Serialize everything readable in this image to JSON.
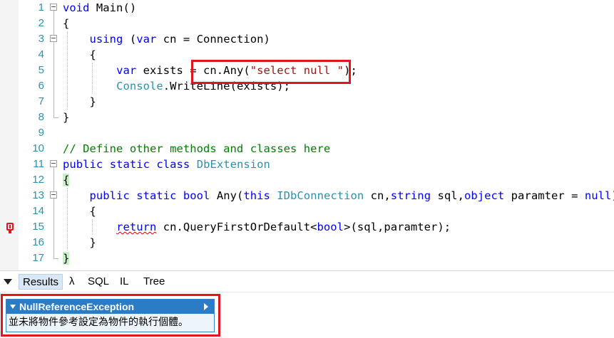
{
  "editor": {
    "lines": [
      {
        "n": "1",
        "tokens": [
          {
            "t": "void",
            "c": "kw"
          },
          {
            "t": " Main()"
          }
        ]
      },
      {
        "n": "2",
        "tokens": [
          {
            "t": "{"
          }
        ]
      },
      {
        "n": "3",
        "tokens": [
          {
            "t": "    "
          },
          {
            "t": "using",
            "c": "kw"
          },
          {
            "t": " ("
          },
          {
            "t": "var",
            "c": "kw"
          },
          {
            "t": " cn = Connection)"
          }
        ]
      },
      {
        "n": "4",
        "tokens": [
          {
            "t": "    {"
          }
        ]
      },
      {
        "n": "5",
        "tokens": [
          {
            "t": "        "
          },
          {
            "t": "var",
            "c": "kw"
          },
          {
            "t": " exists = cn.Any("
          },
          {
            "t": "\"select null \"",
            "c": "str"
          },
          {
            "t": ");"
          }
        ]
      },
      {
        "n": "6",
        "tokens": [
          {
            "t": "        "
          },
          {
            "t": "Console",
            "c": "ty"
          },
          {
            "t": ".WriteLine(exists);"
          }
        ]
      },
      {
        "n": "7",
        "tokens": [
          {
            "t": "    }"
          }
        ]
      },
      {
        "n": "8",
        "tokens": [
          {
            "t": "}"
          }
        ]
      },
      {
        "n": "9",
        "tokens": []
      },
      {
        "n": "10",
        "tokens": [
          {
            "t": "// Define other methods and classes here",
            "c": "cm"
          }
        ]
      },
      {
        "n": "11",
        "tokens": [
          {
            "t": "public",
            "c": "kw"
          },
          {
            "t": " "
          },
          {
            "t": "static",
            "c": "kw"
          },
          {
            "t": " "
          },
          {
            "t": "class",
            "c": "kw"
          },
          {
            "t": " "
          },
          {
            "t": "DbExtension",
            "c": "ty"
          }
        ]
      },
      {
        "n": "12",
        "tokens": [
          {
            "t": "{",
            "c": "brace-hl"
          }
        ]
      },
      {
        "n": "13",
        "tokens": [
          {
            "t": "    "
          },
          {
            "t": "public",
            "c": "kw"
          },
          {
            "t": " "
          },
          {
            "t": "static",
            "c": "kw"
          },
          {
            "t": " "
          },
          {
            "t": "bool",
            "c": "kw"
          },
          {
            "t": " Any("
          },
          {
            "t": "this",
            "c": "kw"
          },
          {
            "t": " "
          },
          {
            "t": "IDbConnection",
            "c": "ty"
          },
          {
            "t": " cn,"
          },
          {
            "t": "string",
            "c": "kw"
          },
          {
            "t": " sql,"
          },
          {
            "t": "object",
            "c": "kw"
          },
          {
            "t": " paramter = "
          },
          {
            "t": "null",
            "c": "kw"
          },
          {
            "t": ")"
          }
        ]
      },
      {
        "n": "14",
        "tokens": [
          {
            "t": "    {"
          }
        ]
      },
      {
        "n": "15",
        "tokens": [
          {
            "t": "        "
          },
          {
            "t": "return",
            "c": "kw err-u"
          },
          {
            "t": " cn.QueryFirstOrDefault<"
          },
          {
            "t": "bool",
            "c": "kw"
          },
          {
            "t": ">(sql,paramter);"
          }
        ]
      },
      {
        "n": "16",
        "tokens": [
          {
            "t": "    }"
          }
        ]
      },
      {
        "n": "17",
        "tokens": [
          {
            "t": "}",
            "c": "brace-hl"
          }
        ]
      }
    ],
    "error_marker_line": "15"
  },
  "tabs": {
    "items": [
      {
        "label": "Results",
        "active": true
      },
      {
        "label": "λ",
        "active": false
      },
      {
        "label": "SQL",
        "active": false
      },
      {
        "label": "IL",
        "active": false
      },
      {
        "label": "Tree",
        "active": false
      }
    ]
  },
  "results": {
    "exception_type": "NullReferenceException",
    "exception_message": "並未將物件參考設定為物件的執行個體。"
  },
  "icons": {
    "collapse": "collapse-triangle-icon",
    "error": "exception-marker-icon",
    "expand": "expand-arrow-icon"
  },
  "colors": {
    "keyword": "#0000ff",
    "type": "#2b91af",
    "string": "#a31515",
    "comment": "#008000",
    "highlight_box": "#e0151d",
    "exception_header": "#2a7cc7"
  }
}
